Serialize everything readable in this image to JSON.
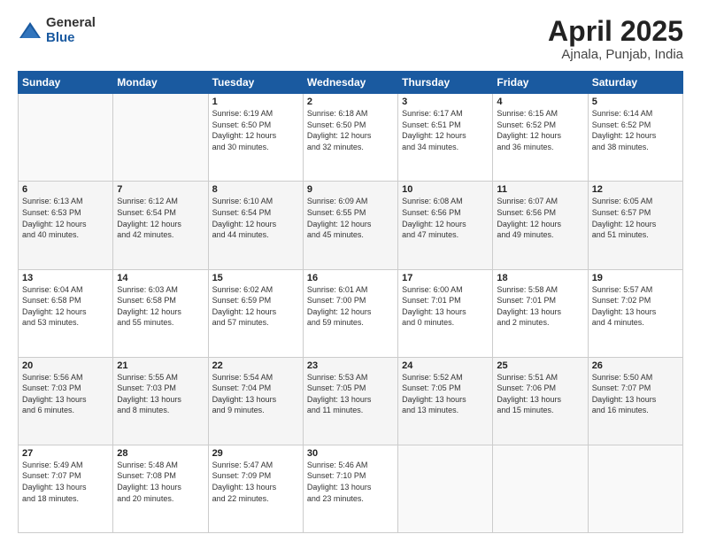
{
  "logo": {
    "general": "General",
    "blue": "Blue"
  },
  "title": {
    "main": "April 2025",
    "sub": "Ajnala, Punjab, India"
  },
  "weekdays": [
    "Sunday",
    "Monday",
    "Tuesday",
    "Wednesday",
    "Thursday",
    "Friday",
    "Saturday"
  ],
  "weeks": [
    [
      {
        "day": "",
        "info": ""
      },
      {
        "day": "",
        "info": ""
      },
      {
        "day": "1",
        "info": "Sunrise: 6:19 AM\nSunset: 6:50 PM\nDaylight: 12 hours\nand 30 minutes."
      },
      {
        "day": "2",
        "info": "Sunrise: 6:18 AM\nSunset: 6:50 PM\nDaylight: 12 hours\nand 32 minutes."
      },
      {
        "day": "3",
        "info": "Sunrise: 6:17 AM\nSunset: 6:51 PM\nDaylight: 12 hours\nand 34 minutes."
      },
      {
        "day": "4",
        "info": "Sunrise: 6:15 AM\nSunset: 6:52 PM\nDaylight: 12 hours\nand 36 minutes."
      },
      {
        "day": "5",
        "info": "Sunrise: 6:14 AM\nSunset: 6:52 PM\nDaylight: 12 hours\nand 38 minutes."
      }
    ],
    [
      {
        "day": "6",
        "info": "Sunrise: 6:13 AM\nSunset: 6:53 PM\nDaylight: 12 hours\nand 40 minutes."
      },
      {
        "day": "7",
        "info": "Sunrise: 6:12 AM\nSunset: 6:54 PM\nDaylight: 12 hours\nand 42 minutes."
      },
      {
        "day": "8",
        "info": "Sunrise: 6:10 AM\nSunset: 6:54 PM\nDaylight: 12 hours\nand 44 minutes."
      },
      {
        "day": "9",
        "info": "Sunrise: 6:09 AM\nSunset: 6:55 PM\nDaylight: 12 hours\nand 45 minutes."
      },
      {
        "day": "10",
        "info": "Sunrise: 6:08 AM\nSunset: 6:56 PM\nDaylight: 12 hours\nand 47 minutes."
      },
      {
        "day": "11",
        "info": "Sunrise: 6:07 AM\nSunset: 6:56 PM\nDaylight: 12 hours\nand 49 minutes."
      },
      {
        "day": "12",
        "info": "Sunrise: 6:05 AM\nSunset: 6:57 PM\nDaylight: 12 hours\nand 51 minutes."
      }
    ],
    [
      {
        "day": "13",
        "info": "Sunrise: 6:04 AM\nSunset: 6:58 PM\nDaylight: 12 hours\nand 53 minutes."
      },
      {
        "day": "14",
        "info": "Sunrise: 6:03 AM\nSunset: 6:58 PM\nDaylight: 12 hours\nand 55 minutes."
      },
      {
        "day": "15",
        "info": "Sunrise: 6:02 AM\nSunset: 6:59 PM\nDaylight: 12 hours\nand 57 minutes."
      },
      {
        "day": "16",
        "info": "Sunrise: 6:01 AM\nSunset: 7:00 PM\nDaylight: 12 hours\nand 59 minutes."
      },
      {
        "day": "17",
        "info": "Sunrise: 6:00 AM\nSunset: 7:01 PM\nDaylight: 13 hours\nand 0 minutes."
      },
      {
        "day": "18",
        "info": "Sunrise: 5:58 AM\nSunset: 7:01 PM\nDaylight: 13 hours\nand 2 minutes."
      },
      {
        "day": "19",
        "info": "Sunrise: 5:57 AM\nSunset: 7:02 PM\nDaylight: 13 hours\nand 4 minutes."
      }
    ],
    [
      {
        "day": "20",
        "info": "Sunrise: 5:56 AM\nSunset: 7:03 PM\nDaylight: 13 hours\nand 6 minutes."
      },
      {
        "day": "21",
        "info": "Sunrise: 5:55 AM\nSunset: 7:03 PM\nDaylight: 13 hours\nand 8 minutes."
      },
      {
        "day": "22",
        "info": "Sunrise: 5:54 AM\nSunset: 7:04 PM\nDaylight: 13 hours\nand 9 minutes."
      },
      {
        "day": "23",
        "info": "Sunrise: 5:53 AM\nSunset: 7:05 PM\nDaylight: 13 hours\nand 11 minutes."
      },
      {
        "day": "24",
        "info": "Sunrise: 5:52 AM\nSunset: 7:05 PM\nDaylight: 13 hours\nand 13 minutes."
      },
      {
        "day": "25",
        "info": "Sunrise: 5:51 AM\nSunset: 7:06 PM\nDaylight: 13 hours\nand 15 minutes."
      },
      {
        "day": "26",
        "info": "Sunrise: 5:50 AM\nSunset: 7:07 PM\nDaylight: 13 hours\nand 16 minutes."
      }
    ],
    [
      {
        "day": "27",
        "info": "Sunrise: 5:49 AM\nSunset: 7:07 PM\nDaylight: 13 hours\nand 18 minutes."
      },
      {
        "day": "28",
        "info": "Sunrise: 5:48 AM\nSunset: 7:08 PM\nDaylight: 13 hours\nand 20 minutes."
      },
      {
        "day": "29",
        "info": "Sunrise: 5:47 AM\nSunset: 7:09 PM\nDaylight: 13 hours\nand 22 minutes."
      },
      {
        "day": "30",
        "info": "Sunrise: 5:46 AM\nSunset: 7:10 PM\nDaylight: 13 hours\nand 23 minutes."
      },
      {
        "day": "",
        "info": ""
      },
      {
        "day": "",
        "info": ""
      },
      {
        "day": "",
        "info": ""
      }
    ]
  ]
}
